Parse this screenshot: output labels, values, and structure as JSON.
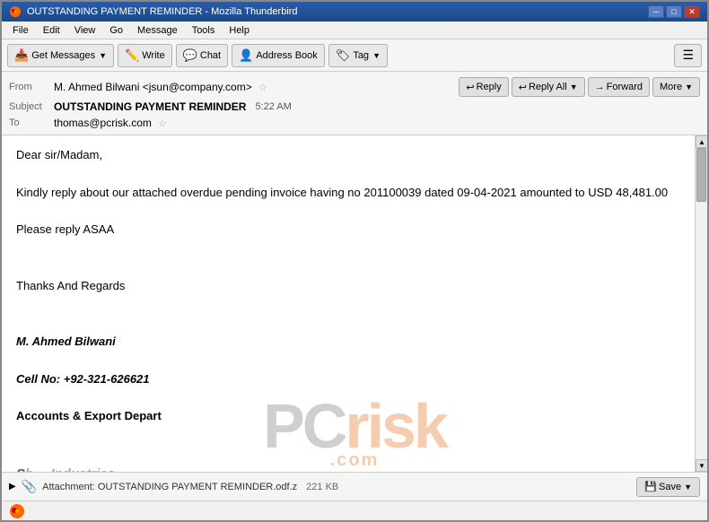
{
  "window": {
    "title": "OUTSTANDING PAYMENT REMINDER - Mozilla Thunderbird",
    "icon": "TB"
  },
  "menu": {
    "items": [
      "File",
      "Edit",
      "View",
      "Go",
      "Message",
      "Tools",
      "Help"
    ]
  },
  "toolbar": {
    "get_messages": "Get Messages",
    "write": "Write",
    "chat": "Chat",
    "address_book": "Address Book",
    "tag": "Tag"
  },
  "email_actions": {
    "reply": "Reply",
    "reply_all": "Reply All",
    "forward": "Forward",
    "more": "More"
  },
  "email": {
    "from_label": "From",
    "from_name": "M. Ahmed Bilwani",
    "from_email": "<jsun@company.com>",
    "subject_label": "Subject",
    "subject": "OUTSTANDING PAYMENT REMINDER",
    "to_label": "To",
    "to_email": "thomas@pcrisk.com",
    "timestamp": "5:22 AM",
    "body_lines": [
      "",
      "Dear sir/Madam,",
      "",
      "Kindly reply about our attached overdue pending invoice having no 201100039 dated 09-04-2021 amounted to USD 48,481.00",
      "",
      "Please reply ASAA",
      "",
      "",
      "Thanks And Regards",
      "",
      "",
      "M. Ahmed Bilwani",
      "",
      "Cell No: +92-321-626621",
      "",
      "Accounts & Export Depart"
    ]
  },
  "attachment": {
    "name": "Attachment: OUTSTANDING PAYMENT REMINDER.odf.z",
    "size": "221 KB",
    "save_label": "Save"
  },
  "status": {
    "text": ""
  }
}
